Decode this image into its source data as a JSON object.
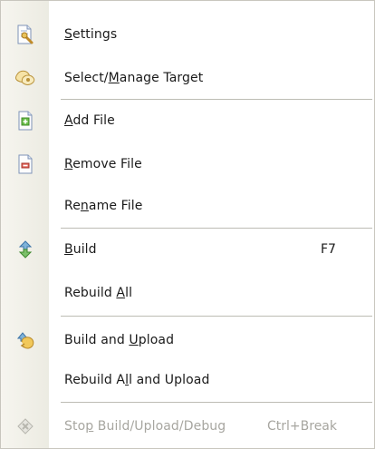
{
  "menu": {
    "items": [
      {
        "label": "Settings",
        "mnemonic": "S",
        "icon": "settings-icon"
      },
      {
        "label": "Select/Manage Target",
        "mnemonic": "M",
        "icon": "target-icon"
      },
      {
        "label": "Add File",
        "mnemonic": "A",
        "icon": "add-file-icon"
      },
      {
        "label": "Remove File",
        "mnemonic": "R",
        "icon": "remove-file-icon"
      },
      {
        "label": "Rename File",
        "mnemonic": "n"
      },
      {
        "label": "Build",
        "mnemonic": "B",
        "shortcut": "F7",
        "icon": "build-icon"
      },
      {
        "label": "Rebuild All",
        "mnemonic": "A"
      },
      {
        "label": "Build and Upload",
        "mnemonic": "U",
        "icon": "build-upload-icon"
      },
      {
        "label": "Rebuild All and Upload",
        "mnemonic": "l"
      },
      {
        "label": "Stop Build/Upload/Debug",
        "mnemonic": "p",
        "shortcut": "Ctrl+Break",
        "icon": "stop-icon",
        "disabled": true
      }
    ]
  }
}
